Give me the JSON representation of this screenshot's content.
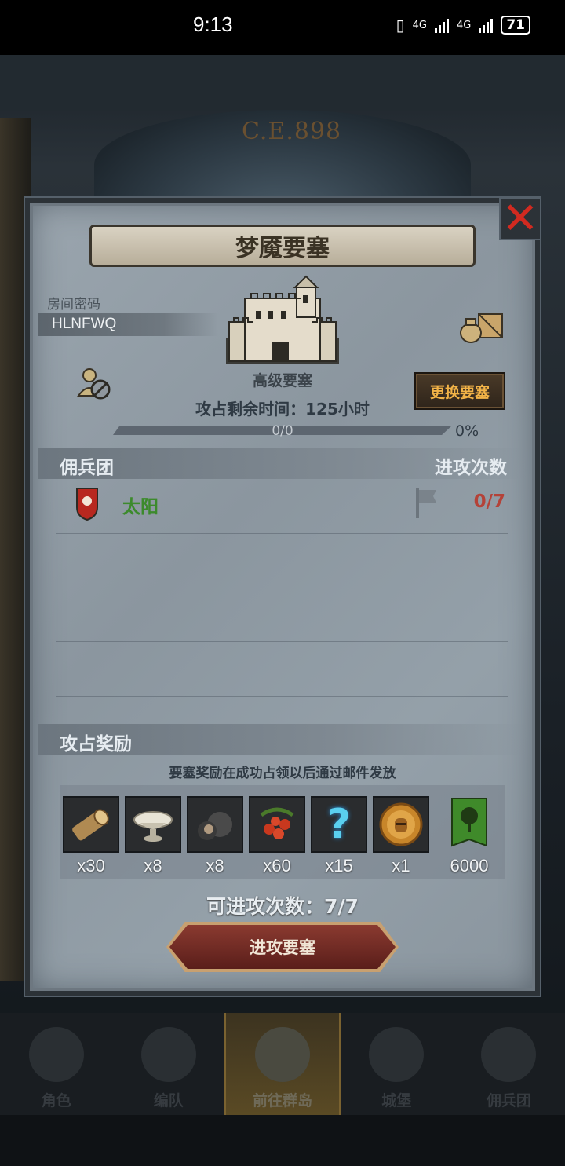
{
  "status_bar": {
    "time": "9:13",
    "network_1": "4G",
    "network_2": "4G",
    "battery": "71"
  },
  "background": {
    "era_label": "C.E.898"
  },
  "dialog": {
    "title": "梦魇要塞",
    "room_code_label": "房间密码",
    "room_code": "HLNFWQ",
    "fortress_level": "高级要塞",
    "time_left": "攻占剩余时间：125小时",
    "change_button": "更换要塞",
    "progress": {
      "current": 0,
      "max": 0,
      "text": "0/0",
      "percent_label": "0%",
      "fraction": 0
    },
    "mercenary_header": "佣兵团",
    "attack_count_header": "进攻次数",
    "mercenaries": [
      {
        "name": "太阳",
        "attacks": "0/7",
        "name_color": "#3c8a2c"
      }
    ],
    "rewards_header": "攻占奖励",
    "rewards_note": "要塞奖励在成功占领以后通过邮件发放",
    "rewards": [
      {
        "icon": "wood-log-icon",
        "qty": "x30"
      },
      {
        "icon": "silver-bowl-icon",
        "qty": "x8"
      },
      {
        "icon": "ore-icon",
        "qty": "x8"
      },
      {
        "icon": "berries-icon",
        "qty": "x60"
      },
      {
        "icon": "mystery-question-icon",
        "qty": "x15"
      },
      {
        "icon": "golden-helmet-coin-icon",
        "qty": "x1"
      },
      {
        "icon": "green-tree-banner-icon",
        "qty": "6000"
      }
    ],
    "attacks_available": "可进攻次数：7/7",
    "attack_button": "进攻要塞"
  },
  "bottom_nav": [
    {
      "label": "角色",
      "icon": "knight-icon"
    },
    {
      "label": "编队",
      "icon": "helmet-icon"
    },
    {
      "label": "前往群岛",
      "icon": "island-map-icon",
      "active": true
    },
    {
      "label": "城堡",
      "icon": "castle-icon"
    },
    {
      "label": "佣兵团",
      "icon": "mercenary-icon"
    }
  ],
  "colors": {
    "accent_gold": "#f2b347",
    "danger_red": "#d22a20",
    "name_green": "#3c8a2c",
    "count_red": "#b44238"
  }
}
